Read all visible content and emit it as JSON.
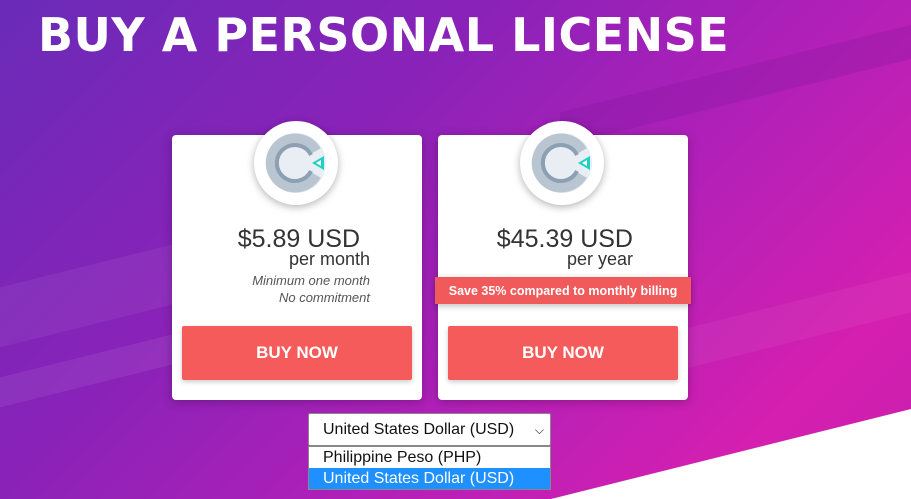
{
  "heading": "BUY A PERSONAL LICENSE",
  "plans": [
    {
      "price": "$5.89 USD",
      "period": "per month",
      "notes": [
        "Minimum one month",
        "No commitment"
      ],
      "button_label": "BUY NOW"
    },
    {
      "price": "$45.39 USD",
      "period": "per year",
      "banner": "Save 35% compared to monthly billing",
      "button_label": "BUY NOW"
    }
  ],
  "currency": {
    "selected": "United States Dollar (USD)",
    "options": [
      "Philippine Peso (PHP)",
      "United States Dollar (USD)"
    ],
    "highlighted_option": "United States Dollar (USD)"
  },
  "colors": {
    "button": "#f45b5a",
    "banner": "#f05a5a",
    "logo_accent": "#1fd1c4",
    "option_highlight": "#1e90ff"
  },
  "icons": {
    "logo": "product-logo-icon",
    "dropdown": "chevron-down-icon"
  }
}
